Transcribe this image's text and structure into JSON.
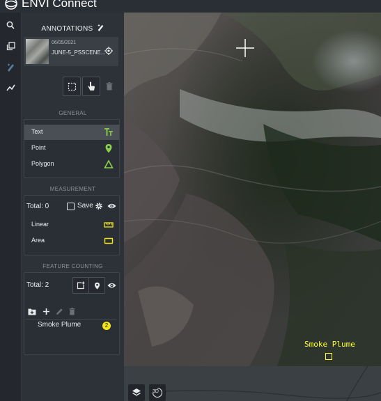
{
  "app": {
    "title": "ENVI Connect"
  },
  "annotations": {
    "title": "ANNOTATIONS",
    "layer": {
      "date": "06/05/2021",
      "name": "JUNE-5_PSSCENE..."
    }
  },
  "general": {
    "section_label": "GENERAL",
    "items": [
      {
        "label": "Text",
        "icon": "text-tool-icon"
      },
      {
        "label": "Point",
        "icon": "map-pin-icon"
      },
      {
        "label": "Polygon",
        "icon": "triangle-icon"
      }
    ]
  },
  "measurement": {
    "section_label": "MEASUREMENT",
    "total": "Total: 0",
    "save_label": "Save",
    "items": [
      {
        "label": "Linear",
        "icon": "ruler-icon"
      },
      {
        "label": "Area",
        "icon": "rectangle-icon"
      }
    ]
  },
  "feature_counting": {
    "section_label": "FEATURE COUNTING",
    "total": "Total: 2",
    "features": [
      {
        "name": "Smoke Plume",
        "count": "2"
      }
    ]
  },
  "map": {
    "label": "Smoke Plume",
    "label_color": "#ffff33",
    "bottom_tools": [
      {
        "icon": "layers-icon"
      },
      {
        "label": "3D",
        "icon": "3d-view-icon"
      }
    ]
  },
  "colors": {
    "accent_green": "#8bd24b",
    "accent_yellow": "#f2e617",
    "panel_bg": "#2d3238"
  }
}
